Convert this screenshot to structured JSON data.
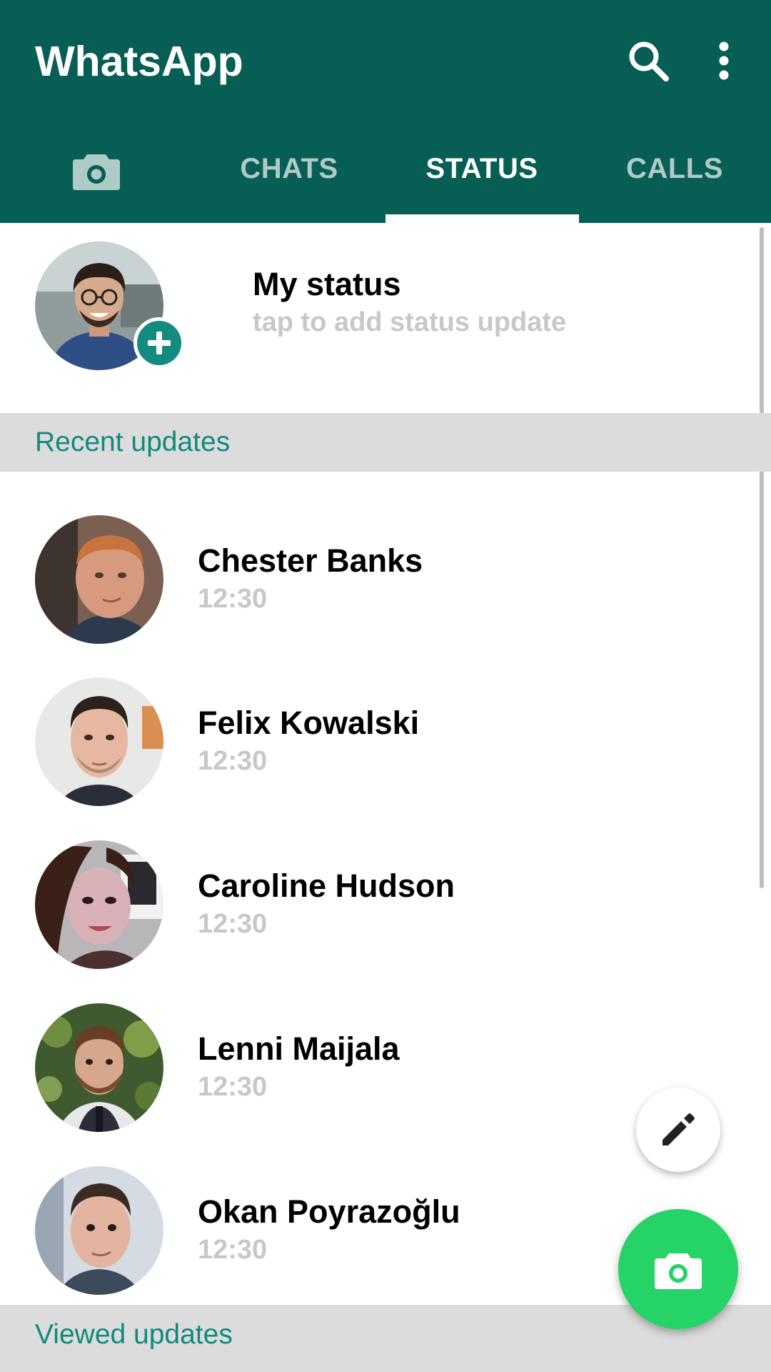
{
  "app": {
    "title": "WhatsApp"
  },
  "header": {
    "icons": [
      "search-icon",
      "more-vertical-icon"
    ]
  },
  "tabs": [
    {
      "label": "",
      "icon": "camera-icon"
    },
    {
      "label": "CHATS"
    },
    {
      "label": "STATUS",
      "active": true
    },
    {
      "label": "CALLS"
    }
  ],
  "my_status": {
    "name": "My status",
    "subtitle": "tap to add status update",
    "badge_icon": "plus-icon"
  },
  "sections": {
    "recent": "Recent updates",
    "viewed": "Viewed updates"
  },
  "contacts": [
    {
      "name": "Chester Banks",
      "time": "12:30"
    },
    {
      "name": "Felix Kowalski",
      "time": "12:30"
    },
    {
      "name": "Caroline Hudson",
      "time": "12:30"
    },
    {
      "name": "Lenni Maijala",
      "time": "12:30"
    },
    {
      "name": "Okan Poyrazoğlu",
      "time": "12:30"
    }
  ],
  "fabs": {
    "edit_icon": "pencil-icon",
    "camera_icon": "camera-icon"
  },
  "colors": {
    "primary": "#075e54",
    "accent_teal": "#128c7e",
    "fab_green": "#25d366",
    "section_text": "#0f8b7d",
    "section_bg": "#dcdcdc",
    "muted_text": "#c8c8c8"
  }
}
